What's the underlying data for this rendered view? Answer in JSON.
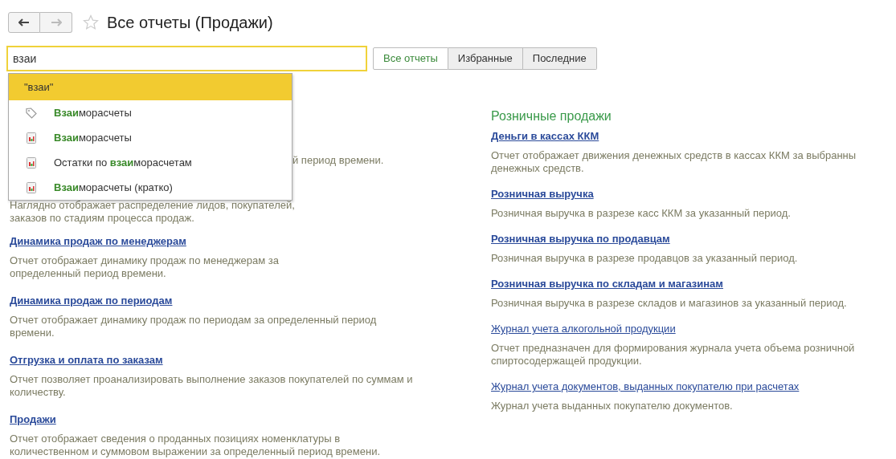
{
  "nav": {
    "back_disabled": false,
    "forward_disabled": true
  },
  "title": "Все отчеты (Продажи)",
  "favorite": false,
  "search": {
    "value": "взаи"
  },
  "filters": [
    {
      "label": "Все отчеты",
      "selected": true
    },
    {
      "label": "Избранные",
      "selected": false
    },
    {
      "label": "Последние",
      "selected": false
    }
  ],
  "suggestions": [
    {
      "kind": "query",
      "text": "\"взаи\"",
      "selected": true
    },
    {
      "kind": "tag",
      "text": "**Взаи**морасчеты",
      "selected": false
    },
    {
      "kind": "report",
      "text": "**Взаи**морасчеты",
      "selected": false
    },
    {
      "kind": "report",
      "text": "Остатки по **взаи**морасчетам",
      "selected": false
    },
    {
      "kind": "report",
      "text": "**Взаи**морасчеты (кратко)",
      "selected": false
    }
  ],
  "left_column": {
    "partial": [
      {
        "description": [
          "й период времени."
        ]
      },
      {
        "description": [
          "Наглядно отображает распределение лидов, покупателей,",
          "заказов по стадиям процесса продаж."
        ]
      }
    ],
    "reports": [
      {
        "title": "Динамика продаж по менеджерам",
        "bold": true,
        "description": [
          "Отчет отображает динамику продаж по менеджерам за",
          "определенный период времени."
        ]
      },
      {
        "title": "Динамика продаж по периодам",
        "bold": true,
        "description": [
          "Отчет отображает динамику продаж по периодам за определенный период",
          "времени."
        ]
      },
      {
        "title": "Отгрузка и оплата по заказам",
        "bold": true,
        "description": [
          "Отчет позволяет проанализировать выполнение заказов покупателей по суммам и",
          "количеству."
        ]
      },
      {
        "title": "Продажи",
        "bold": true,
        "description": [
          "Отчет отображает сведения о проданных позициях номенклатуры в",
          "количественном и суммовом выражении за определенный период времени."
        ]
      }
    ]
  },
  "right_column": {
    "heading": "Розничные продажи",
    "reports": [
      {
        "title": "Деньги в кассах ККМ",
        "bold": true,
        "description": [
          "Отчет отображает движения денежных средств в кассах ККМ за выбранны",
          "денежных средств."
        ]
      },
      {
        "title": "Розничная выручка",
        "bold": true,
        "description": [
          "Розничная выручка в разрезе касс ККМ за указанный период."
        ]
      },
      {
        "title": "Розничная выручка по продавцам",
        "bold": true,
        "description": [
          "Розничная выручка в разрезе продавцов за указанный период."
        ]
      },
      {
        "title": "Розничная выручка по складам и магазинам",
        "bold": true,
        "description": [
          "Розничная выручка в разрезе складов и магазинов за указанный период."
        ]
      },
      {
        "title": "Журнал учета алкогольной продукции",
        "bold": false,
        "description": [
          "Отчет предназначен для формирования журнала учета объема розничной",
          "спиртосодержащей продукции."
        ]
      },
      {
        "title": "Журнал учета документов, выданных покупателю при расчетах",
        "bold": false,
        "description": [
          "Журнал учета выданных покупателю документов."
        ]
      }
    ]
  }
}
